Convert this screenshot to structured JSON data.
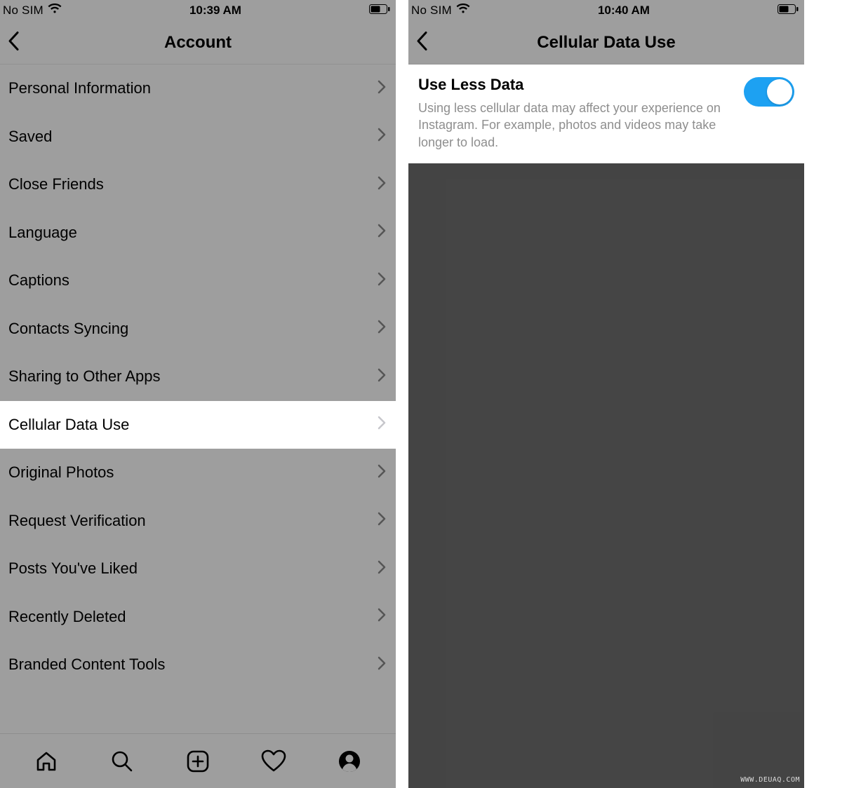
{
  "left": {
    "status": {
      "carrier": "No SIM",
      "time": "10:39 AM"
    },
    "nav": {
      "title": "Account"
    },
    "items": [
      {
        "label": "Personal Information",
        "highlight": false
      },
      {
        "label": "Saved",
        "highlight": false
      },
      {
        "label": "Close Friends",
        "highlight": false
      },
      {
        "label": "Language",
        "highlight": false
      },
      {
        "label": "Captions",
        "highlight": false
      },
      {
        "label": "Contacts Syncing",
        "highlight": false
      },
      {
        "label": "Sharing to Other Apps",
        "highlight": false
      },
      {
        "label": "Cellular Data Use",
        "highlight": true
      },
      {
        "label": "Original Photos",
        "highlight": false
      },
      {
        "label": "Request Verification",
        "highlight": false
      },
      {
        "label": "Posts You've Liked",
        "highlight": false
      },
      {
        "label": "Recently Deleted",
        "highlight": false
      },
      {
        "label": "Branded Content Tools",
        "highlight": false
      }
    ]
  },
  "right": {
    "status": {
      "carrier": "No SIM",
      "time": "10:40 AM"
    },
    "nav": {
      "title": "Cellular Data Use"
    },
    "setting": {
      "title": "Use Less Data",
      "description": "Using less cellular data may affect your experience on Instagram. For example, photos and videos may take longer to load.",
      "enabled": true
    }
  },
  "watermark": "WWW.DEUAQ.COM"
}
